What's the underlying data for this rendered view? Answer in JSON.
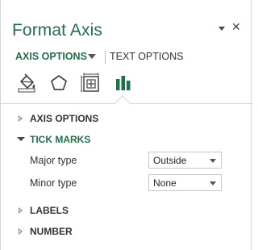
{
  "pane": {
    "title": "Format Axis",
    "tabs": {
      "axis_options": "AXIS OPTIONS",
      "text_options": "TEXT OPTIONS"
    },
    "icons": [
      "fill-line-icon",
      "effects-icon",
      "size-properties-icon",
      "axis-options-icon"
    ],
    "accent_color": "#1f7246"
  },
  "sections": {
    "axis_options": "AXIS OPTIONS",
    "tick_marks": "TICK MARKS",
    "labels": "LABELS",
    "number": "NUMBER"
  },
  "tick_marks": {
    "major_type": {
      "label": "Major type",
      "value": "Outside"
    },
    "minor_type": {
      "label": "Minor type",
      "value": "None"
    }
  }
}
